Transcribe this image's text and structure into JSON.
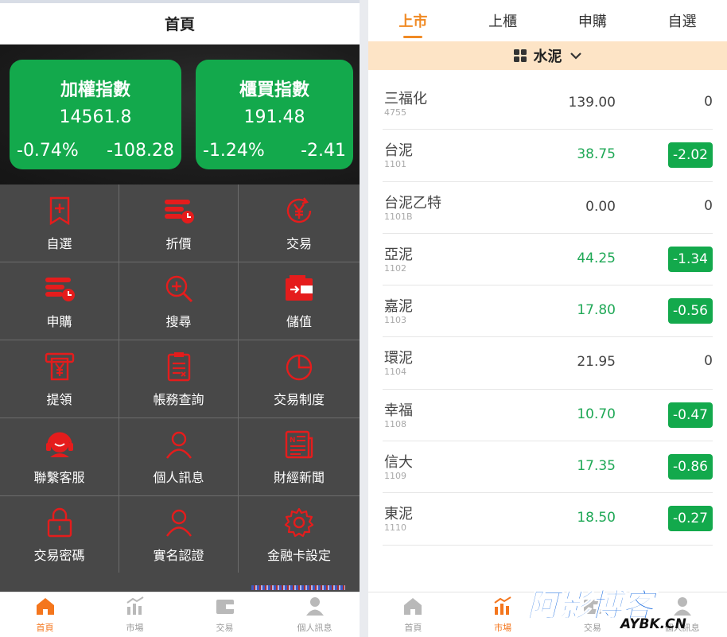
{
  "left": {
    "title": "首頁",
    "indices": [
      {
        "name": "加權指數",
        "value": "14561.8",
        "pct": "-0.74%",
        "change": "-108.28"
      },
      {
        "name": "櫃買指數",
        "value": "191.48",
        "pct": "-1.24%",
        "change": "-2.41"
      }
    ],
    "menu": [
      {
        "label": "自選",
        "icon": "bookmark-add-icon"
      },
      {
        "label": "折價",
        "icon": "stack-clock-icon"
      },
      {
        "label": "交易",
        "icon": "yen-refresh-icon"
      },
      {
        "label": "申購",
        "icon": "stack-clock-icon"
      },
      {
        "label": "搜尋",
        "icon": "search-plus-icon"
      },
      {
        "label": "儲值",
        "icon": "wallet-icon"
      },
      {
        "label": "提領",
        "icon": "atm-yen-icon"
      },
      {
        "label": "帳務查詢",
        "icon": "ledger-icon"
      },
      {
        "label": "交易制度",
        "icon": "pie-chart-icon"
      },
      {
        "label": "聯繫客服",
        "icon": "headset-icon"
      },
      {
        "label": "個人訊息",
        "icon": "user-icon"
      },
      {
        "label": "財經新聞",
        "icon": "newspaper-icon"
      },
      {
        "label": "交易密碼",
        "icon": "lock-icon"
      },
      {
        "label": "實名認證",
        "icon": "user-icon"
      },
      {
        "label": "金融卡設定",
        "icon": "gear-icon"
      }
    ],
    "tabbar": [
      {
        "label": "首頁",
        "icon": "home-icon",
        "active": true
      },
      {
        "label": "市場",
        "icon": "chart-icon",
        "active": false
      },
      {
        "label": "交易",
        "icon": "wallet-icon",
        "active": false
      },
      {
        "label": "個人訊息",
        "icon": "user-icon",
        "active": false
      }
    ]
  },
  "right": {
    "tabs": [
      {
        "label": "上市",
        "active": true
      },
      {
        "label": "上櫃",
        "active": false
      },
      {
        "label": "申購",
        "active": false
      },
      {
        "label": "自選",
        "active": false
      }
    ],
    "category": "水泥",
    "stocks": [
      {
        "name": "三福化",
        "code": "4755",
        "price": "139.00",
        "change": "0",
        "down": false
      },
      {
        "name": "台泥",
        "code": "1101",
        "price": "38.75",
        "change": "-2.02",
        "down": true
      },
      {
        "name": "台泥乙特",
        "code": "1101B",
        "price": "0.00",
        "change": "0",
        "down": false
      },
      {
        "name": "亞泥",
        "code": "1102",
        "price": "44.25",
        "change": "-1.34",
        "down": true
      },
      {
        "name": "嘉泥",
        "code": "1103",
        "price": "17.80",
        "change": "-0.56",
        "down": true
      },
      {
        "name": "環泥",
        "code": "1104",
        "price": "21.95",
        "change": "0",
        "down": false
      },
      {
        "name": "幸福",
        "code": "1108",
        "price": "10.70",
        "change": "-0.47",
        "down": true
      },
      {
        "name": "信大",
        "code": "1109",
        "price": "17.35",
        "change": "-0.86",
        "down": true
      },
      {
        "name": "東泥",
        "code": "1110",
        "price": "18.50",
        "change": "-0.27",
        "down": true
      }
    ],
    "tabbar": [
      {
        "label": "首頁",
        "icon": "home-icon",
        "active": false
      },
      {
        "label": "市場",
        "icon": "chart-icon",
        "active": true
      },
      {
        "label": "交易",
        "icon": "wallet-icon",
        "active": false
      },
      {
        "label": "個人訊息",
        "icon": "user-icon",
        "active": false
      }
    ],
    "watermark": {
      "main": "阿影博客",
      "sub": "AYBK.CN"
    }
  },
  "colors": {
    "green": "#13a94c",
    "orange": "#f4761d",
    "red": "#e51c1c",
    "grid": "#484848"
  }
}
